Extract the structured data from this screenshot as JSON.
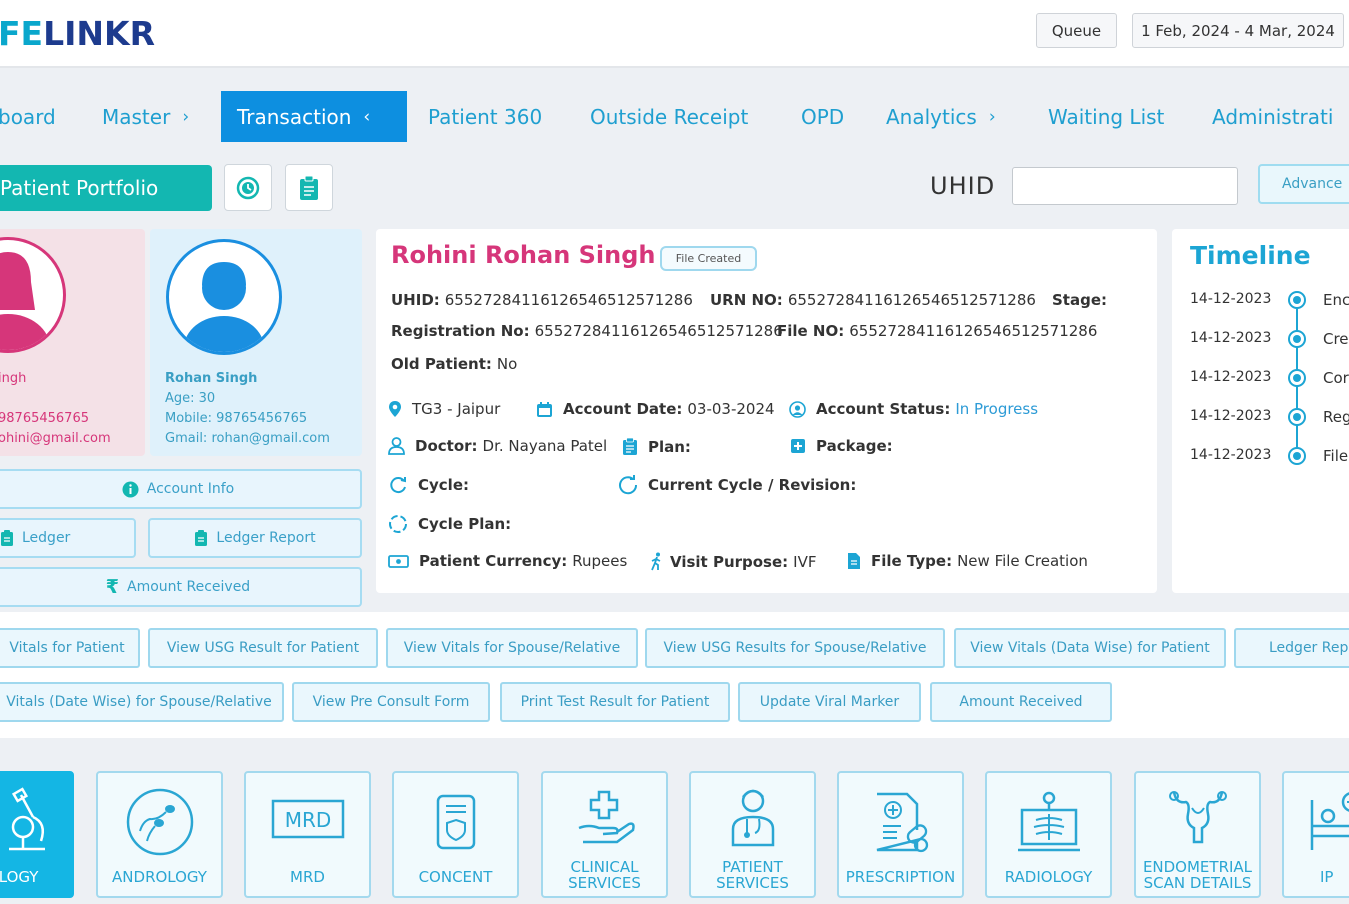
{
  "header": {
    "logo_text_a": "FE",
    "logo_text_b": "LINKR",
    "queue_label": "Queue",
    "date_range": "1 Feb, 2024 - 4 Mar, 2024"
  },
  "nav": {
    "items": [
      {
        "label": "board"
      },
      {
        "label": "Master"
      },
      {
        "label": "Transaction"
      },
      {
        "label": "Patient 360"
      },
      {
        "label": "Outside Receipt"
      },
      {
        "label": "OPD"
      },
      {
        "label": "Analytics"
      },
      {
        "label": "Waiting List"
      },
      {
        "label": "Administrati"
      }
    ]
  },
  "toolbar": {
    "portfolio_label": "Patient Portfolio",
    "uhid_label": "UHID",
    "uhid_value": "",
    "advance_label": "Advance"
  },
  "female": {
    "name": "ingh",
    "mobile": "98765456765",
    "email": "ohini@gmail.com"
  },
  "male": {
    "name": "Rohan Singh",
    "age": "Age: 30",
    "mobile": "Mobile: 98765456765",
    "email": "Gmail: rohan@gmail.com"
  },
  "side_buttons": {
    "account_info": "Account Info",
    "ledger": "Ledger",
    "ledger_report": "Ledger Report",
    "amount_received": "Amount Received"
  },
  "patient": {
    "name": "Rohini Rohan Singh",
    "badge": "File Created",
    "uhid_label": "UHID:",
    "uhid": "6552728411612654651257128​6",
    "urn_label": "URN NO:",
    "urn": "6552728411612654651257128​6",
    "stage_label": "Stage:",
    "reg_label": "Registration No:",
    "reg": "6552728411612654651257128​6",
    "file_label": "File NO:",
    "file": "6552728411612654651257128​6",
    "old_label": "Old Patient:",
    "old": "No",
    "location": "TG3 - Jaipur",
    "account_date_label": "Account Date:",
    "account_date": "03-03-2024",
    "account_status_label": "Account Status:",
    "account_status": "In Progress",
    "doctor_label": "Doctor:",
    "doctor": "Dr. Nayana Patel",
    "plan_label": "Plan:",
    "package_label": "Package:",
    "cycle_label": "Cycle:",
    "current_cycle_label": "Current Cycle / Revision:",
    "cycle_plan_label": "Cycle Plan:",
    "currency_label": "Patient Currency:",
    "currency": "Rupees",
    "visit_label": "Visit Purpose:",
    "visit": "IVF",
    "filetype_label": "File Type:",
    "filetype": "New File Creation"
  },
  "timeline": {
    "title": "Timeline",
    "entries": [
      {
        "date": "14-12-2023",
        "text": "Enc"
      },
      {
        "date": "14-12-2023",
        "text": "Cre"
      },
      {
        "date": "14-12-2023",
        "text": "Cor"
      },
      {
        "date": "14-12-2023",
        "text": "Reg"
      },
      {
        "date": "14-12-2023",
        "text": "File"
      }
    ]
  },
  "actions": {
    "row1": [
      "Vitals for Patient",
      "View USG Result for Patient",
      "View Vitals for Spouse/Relative",
      "View USG Results for Spouse/Relative",
      "View Vitals (Data Wise) for Patient",
      "Ledger Rep"
    ],
    "row2": [
      "Vitals (Date Wise) for Spouse/Relative",
      "View Pre Consult Form",
      "Print Test Result for Patient",
      "Update Viral Marker",
      "Amount Received"
    ]
  },
  "modules": [
    {
      "label": "IOLOGY",
      "icon": "microscope-icon"
    },
    {
      "label": "ANDROLOGY",
      "icon": "sperm-icon"
    },
    {
      "label": "MRD",
      "icon": "mrd-icon"
    },
    {
      "label": "CONCENT",
      "icon": "document-shield-icon"
    },
    {
      "label1": "CLINICAL",
      "label2": "SERVICES",
      "icon": "hand-cross-icon"
    },
    {
      "label1": "PATIENT",
      "label2": "SERVICES",
      "icon": "doctor-icon"
    },
    {
      "label": "PRESCRIPTION",
      "icon": "prescription-icon"
    },
    {
      "label": "RADIOLOGY",
      "icon": "xray-icon"
    },
    {
      "label1": "ENDOMETRIAL",
      "label2": "SCAN DETAILS",
      "icon": "uterus-icon"
    },
    {
      "label": "IP",
      "icon": "bed-icon"
    }
  ],
  "colors": {
    "accent_blue": "#0d8fe0",
    "teal": "#13b7b1",
    "pink": "#d6367a",
    "tile_active": "#14b6e4"
  }
}
